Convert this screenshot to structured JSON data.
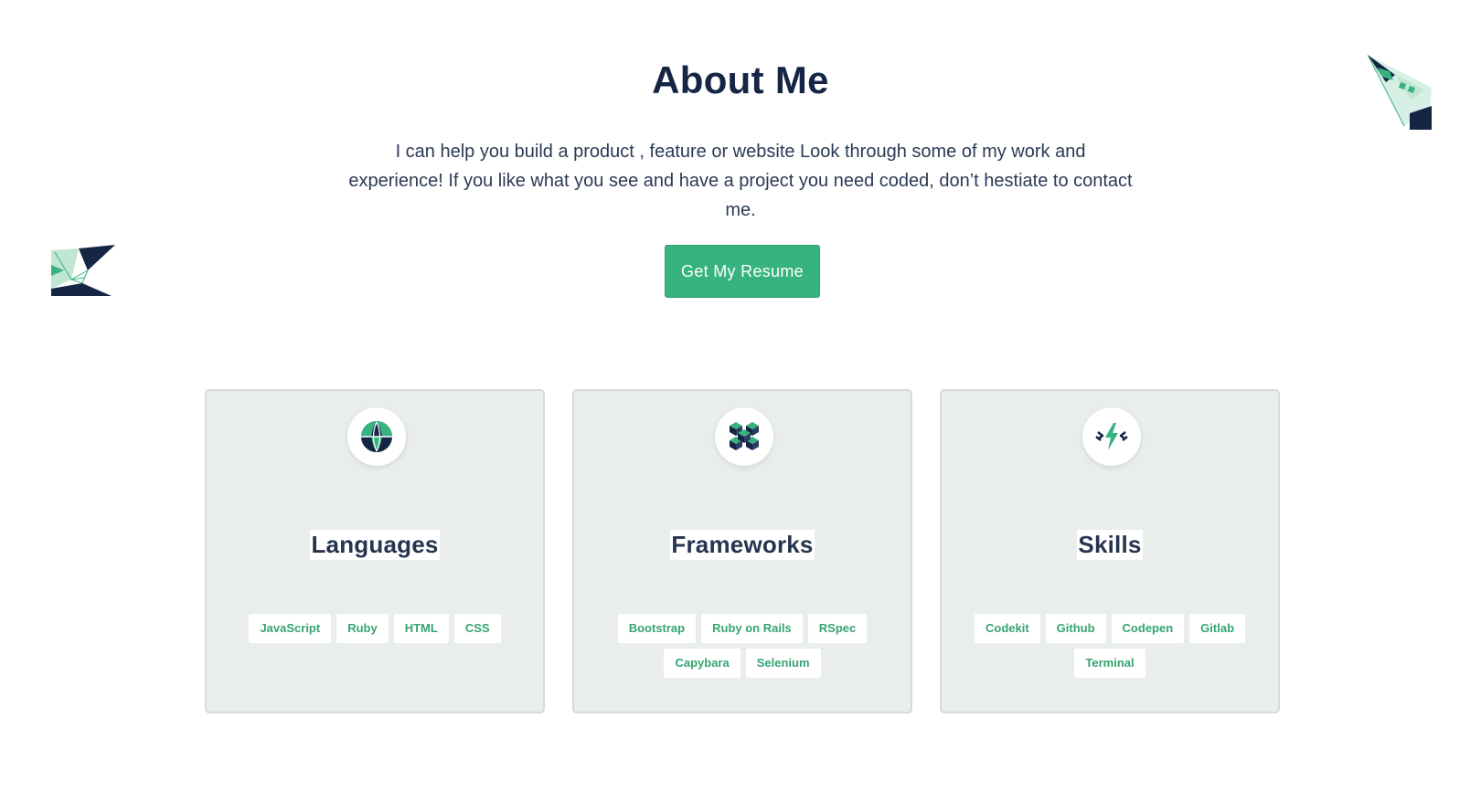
{
  "about": {
    "title": "About Me",
    "intro_line1": "I can help you build a product , feature or website Look through some of my work and",
    "intro_line2": "experience! If you like what you see and have a project you need coded, don’t hestiate to contact",
    "intro_line3": "me.",
    "resume_button": "Get My Resume"
  },
  "cards": [
    {
      "title": "Languages",
      "icon": "globe-icon",
      "tags": [
        "JavaScript",
        "Ruby",
        "HTML",
        "CSS"
      ]
    },
    {
      "title": "Frameworks",
      "icon": "cubes-icon",
      "tags": [
        "Bootstrap",
        "Ruby on Rails",
        "RSpec",
        "Capybara",
        "Selenium"
      ]
    },
    {
      "title": "Skills",
      "icon": "lightning-icon",
      "tags": [
        "Codekit",
        "Github",
        "Codepen",
        "Gitlab",
        "Terminal"
      ]
    }
  ],
  "colors": {
    "accent": "#36b37e",
    "heading": "#152544",
    "card_bg": "#e9edec",
    "tag_text": "#36a572"
  }
}
